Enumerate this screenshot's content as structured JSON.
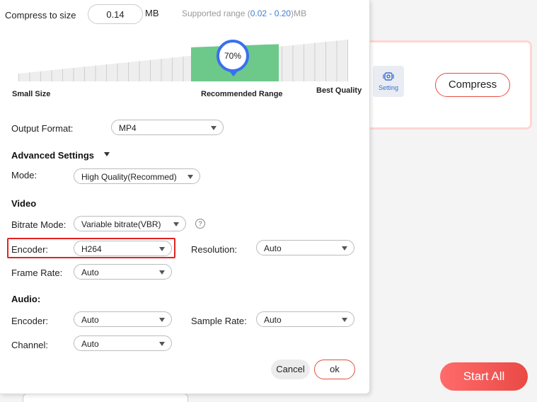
{
  "background": {
    "setting_label": "Setting",
    "compress_button": "Compress",
    "start_all_button": "Start All"
  },
  "dialog": {
    "compress_label": "Compress to size",
    "size_value": "0.14",
    "size_unit": "MB",
    "supported_prefix": "Supported range (",
    "supported_range": "0.02 - 0.20",
    "supported_suffix": ")MB",
    "slider": {
      "percent_label": "70%",
      "value_fraction": 0.7,
      "left_label": "Small Size",
      "center_label": "Recommended Range",
      "right_label": "Best Quality"
    },
    "output_format_label": "Output Format:",
    "output_format_value": "MP4",
    "advanced_settings_label": "Advanced Settings",
    "mode_label": "Mode:",
    "mode_value": "High Quality(Recommed)",
    "video_heading": "Video",
    "bitrate_mode_label": "Bitrate Mode:",
    "bitrate_mode_value": "Variable bitrate(VBR)",
    "help_glyph": "?",
    "video_encoder_label": "Encoder:",
    "video_encoder_value": "H264",
    "resolution_label": "Resolution:",
    "resolution_value": "Auto",
    "frame_rate_label": "Frame Rate:",
    "frame_rate_value": "Auto",
    "audio_heading": "Audio:",
    "audio_encoder_label": "Encoder:",
    "audio_encoder_value": "Auto",
    "sample_rate_label": "Sample Rate:",
    "sample_rate_value": "Auto",
    "channel_label": "Channel:",
    "channel_value": "Auto",
    "cancel_button": "Cancel",
    "ok_button": "ok"
  },
  "colors": {
    "accent_blue": "#3b6ff0",
    "recommended_green": "#6cc98a",
    "highlight_red": "#e22222",
    "range_blue": "#3b7fd4"
  }
}
